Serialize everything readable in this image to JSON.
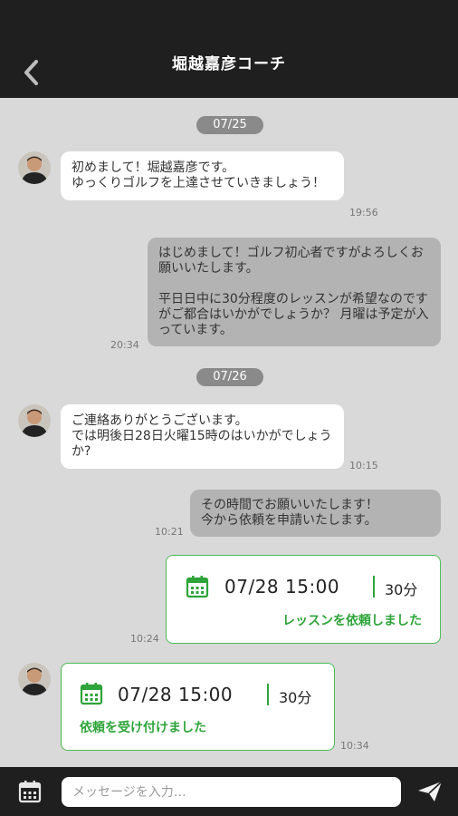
{
  "header": {
    "title": "堀越嘉彦コーチ",
    "back_icon": "chevron-left-icon"
  },
  "dates": [
    "07/25",
    "07/26"
  ],
  "messages": [
    {
      "from": "coach",
      "text": "初めまして！堀越嘉彦です。\nゆっくりゴルフを上達させていきましょう！",
      "time": "19:56"
    },
    {
      "from": "user",
      "text": "はじめまして！ゴルフ初心者ですがよろしくお願いいたします。\n\n平日日中に30分程度のレッスンが希望なのですがご都合はいかがでしょうか？ 月曜は予定が入っています。",
      "time": "20:34"
    },
    {
      "from": "coach",
      "text": "ご連絡ありがとうございます。\nでは明後日28日火曜15時のはいかがでしょうか?",
      "time": "10:15"
    },
    {
      "from": "user",
      "text": "その時間でお願いいたします！\n今から依頼を申請いたします。",
      "time": "10:21"
    }
  ],
  "cards": [
    {
      "from": "user",
      "datetime": "07/28 15:00",
      "duration": "30分",
      "status": "レッスンを依頼しました",
      "time": "10:24"
    },
    {
      "from": "coach",
      "datetime": "07/28 15:00",
      "duration": "30分",
      "status": "依頼を受け付けました",
      "time": "10:34"
    }
  ],
  "footer": {
    "placeholder": "メッセージを入力…",
    "value": "",
    "calendar_icon": "calendar-icon",
    "send_icon": "send-icon"
  },
  "colors": {
    "header_bg": "#1f1f1f",
    "chat_bg": "#d9d9d9",
    "outgoing_bubble": "#b3b3b3",
    "accent_green": "#2ea43a"
  }
}
